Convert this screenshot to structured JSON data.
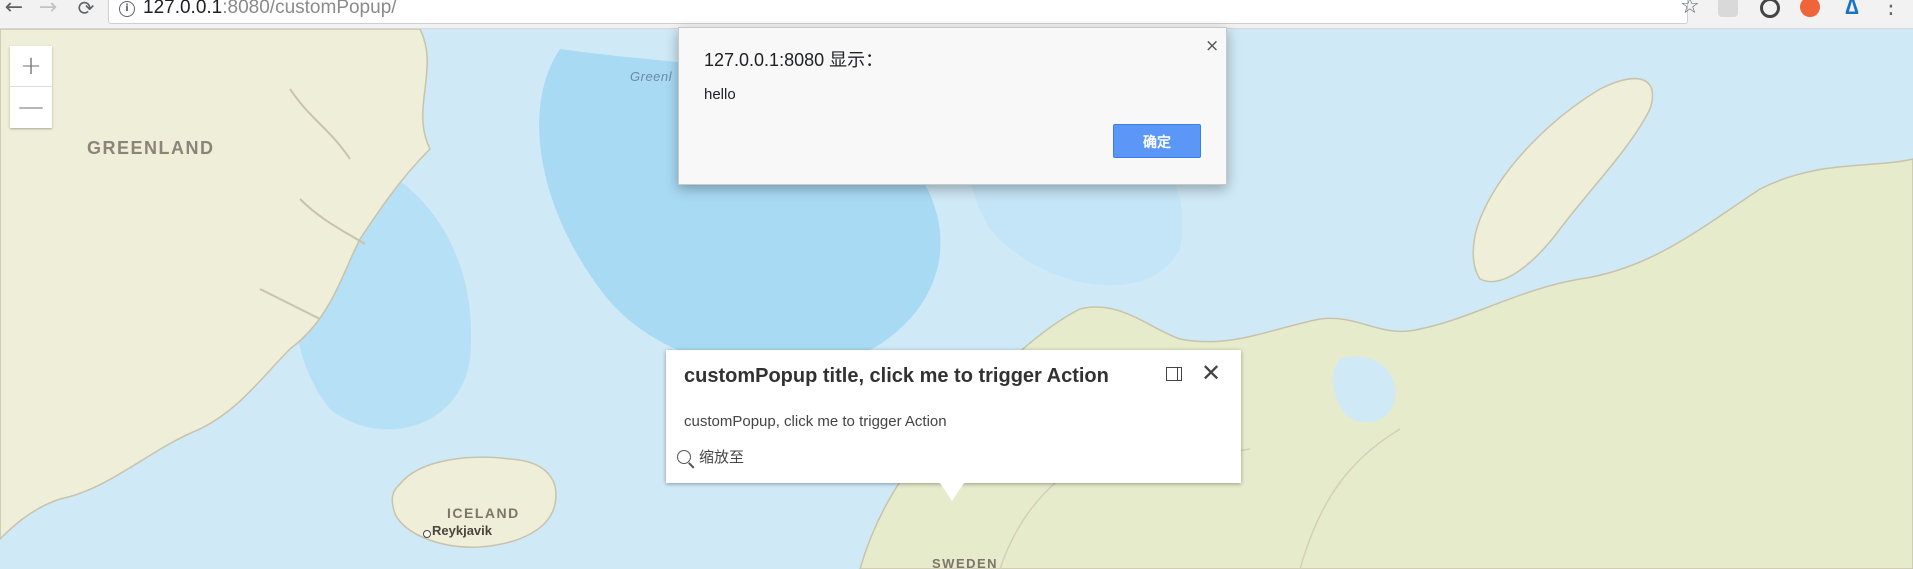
{
  "browser": {
    "url_host": "127.0.0.1",
    "url_rest": ":8080/customPopup/",
    "back_icon": "←",
    "forward_icon": "→",
    "reload_icon": "⟳",
    "info_icon": "i",
    "star_icon": "☆",
    "menu_icon": "⋮"
  },
  "map": {
    "labels": {
      "greenland": "GREENLAND",
      "greenland_sea": "Greenl",
      "iceland": "ICELAND",
      "reykjavik": "Reykjavik",
      "sweden": "SWEDEN"
    },
    "colors": {
      "ocean": "#cfe9f7",
      "deep_ocean": "#9fd5f2",
      "land": "#efeed9",
      "land_green": "#e6ebcc",
      "coast": "#c8c3ab"
    }
  },
  "zoom": {
    "in_label": "+",
    "out_label": "—"
  },
  "alert": {
    "title": "127.0.0.1:8080 显示：",
    "message": "hello",
    "ok_label": "确定",
    "close_label": "×"
  },
  "popup": {
    "title": "customPopup title, click me to trigger Action",
    "body": "customPopup, click me to trigger Action",
    "zoom_to_label": "缩放至",
    "close_label": "✕"
  }
}
